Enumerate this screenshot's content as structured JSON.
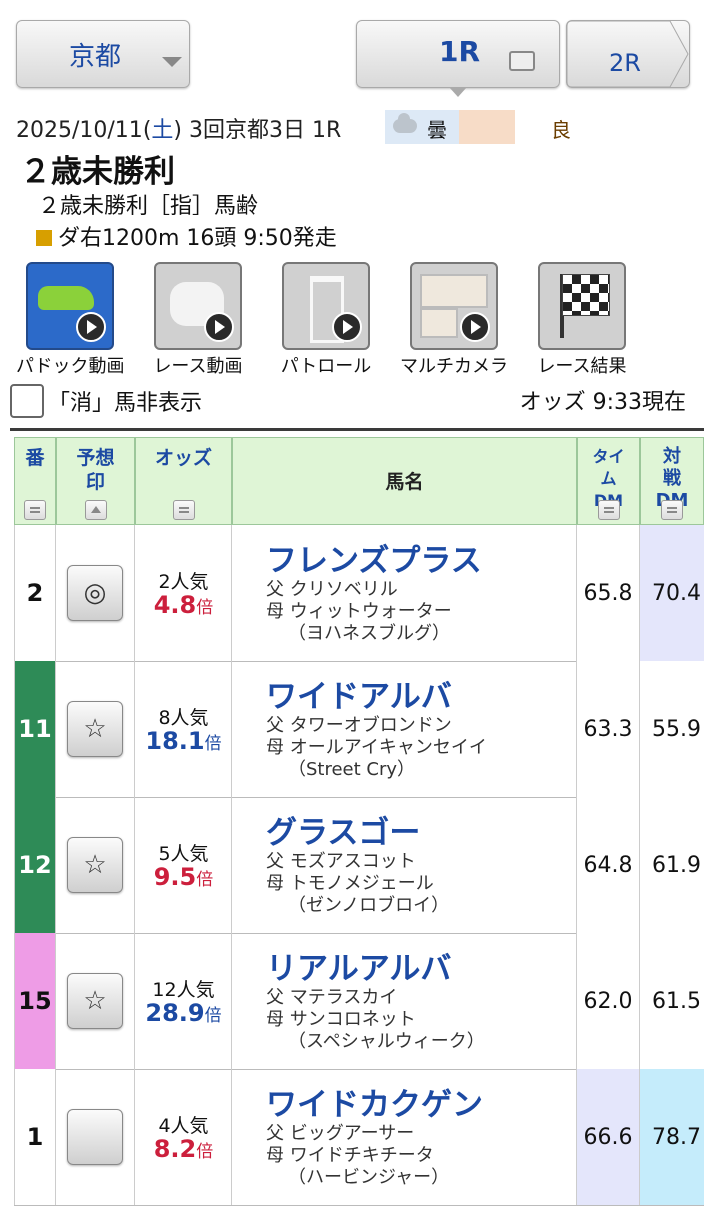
{
  "nav": {
    "venue": "京都",
    "current_race": "1R",
    "next_race": "2R"
  },
  "race_info": {
    "date": "2025/10/11",
    "weekday": "土",
    "meeting": "3回京都3日",
    "race_no": "1R",
    "weather": "曇",
    "track_condition": "良",
    "title": "２歳未勝利",
    "conditions": "２歳未勝利［指］馬齢",
    "course": "ダ右1200m 16頭 9:50発走"
  },
  "media": [
    {
      "label": "パドック動画",
      "icon": "paddock-icon"
    },
    {
      "label": "レース動画",
      "icon": "race-video-icon"
    },
    {
      "label": "パトロール",
      "icon": "patrol-icon"
    },
    {
      "label": "マルチカメラ",
      "icon": "multicamera-icon"
    },
    {
      "label": "レース結果",
      "icon": "checkered-flag-icon"
    }
  ],
  "filter": {
    "hide_scratched_label": "「消」馬非表示",
    "odds_time": "オッズ 9:33現在"
  },
  "table": {
    "headers": {
      "num": "番",
      "mark": "予想印",
      "odds": "オッズ",
      "name": "馬名",
      "time_dm": "タイムDM",
      "vs_dm": "対戦DM"
    },
    "rows": [
      {
        "num": "2",
        "mark": "◎",
        "popularity": "2人気",
        "odds": "4.8",
        "odds_unit": "倍",
        "name": "フレンズプラス",
        "sire": "父 クリソベリル",
        "dam": "母 ウィットウォーター",
        "damsire": "（ヨハネスブルグ）",
        "time_dm": "65.8",
        "vs_dm": "70.4"
      },
      {
        "num": "11",
        "mark": "☆",
        "popularity": "8人気",
        "odds": "18.1",
        "odds_unit": "倍",
        "name": "ワイドアルバ",
        "sire": "父 タワーオブロンドン",
        "dam": "母 オールアイキャンセイイ",
        "damsire": "（Street Cry）",
        "time_dm": "63.3",
        "vs_dm": "55.9"
      },
      {
        "num": "12",
        "mark": "☆",
        "popularity": "5人気",
        "odds": "9.5",
        "odds_unit": "倍",
        "name": "グラスゴー",
        "sire": "父 モズアスコット",
        "dam": "母 トモノメジェール",
        "damsire": "（ゼンノロブロイ）",
        "time_dm": "64.8",
        "vs_dm": "61.9"
      },
      {
        "num": "15",
        "mark": "☆",
        "popularity": "12人気",
        "odds": "28.9",
        "odds_unit": "倍",
        "name": "リアルアルバ",
        "sire": "父 マテラスカイ",
        "dam": "母 サンコロネット",
        "damsire": "（スペシャルウィーク）",
        "time_dm": "62.0",
        "vs_dm": "61.5"
      },
      {
        "num": "1",
        "mark": "",
        "popularity": "4人気",
        "odds": "8.2",
        "odds_unit": "倍",
        "name": "ワイドカクゲン",
        "sire": "父 ビッグアーサー",
        "dam": "母 ワイドチキチータ",
        "damsire": "（ハービンジャー）",
        "time_dm": "66.6",
        "vs_dm": "78.7"
      }
    ]
  },
  "colors": {
    "accent": "#1c4aa3",
    "odds_low": "#cc1f3c",
    "odds_high": "#1c4aa3",
    "gate_green": "#2e8b57",
    "gate_pink": "#ee9ce6",
    "header_bg": "#dff5d6",
    "vs_highlight_1": "#e4e6fb",
    "vs_highlight_2": "#c5ecfb",
    "time_highlight": "#e4e6fb"
  }
}
